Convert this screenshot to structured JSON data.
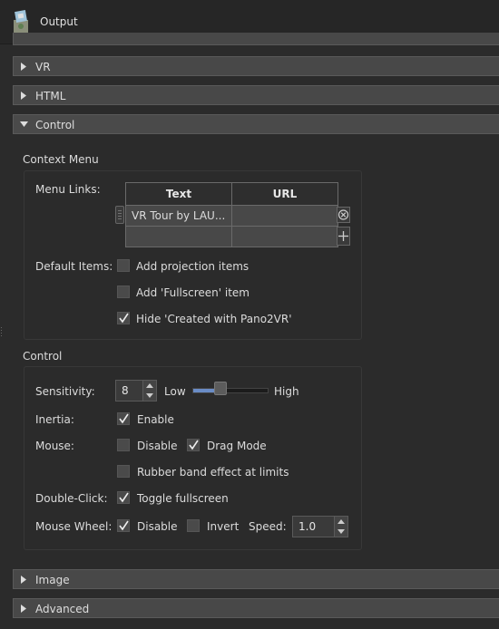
{
  "window": {
    "title": "Output",
    "icon": "pano2vr-app-icon"
  },
  "sections": {
    "vr": "VR",
    "html": "HTML",
    "control": "Control",
    "image": "Image",
    "advanced": "Advanced"
  },
  "context_menu": {
    "title": "Context Menu",
    "menu_links_label": "Menu Links:",
    "table": {
      "columns": [
        "Text",
        "URL"
      ],
      "rows": [
        {
          "text": "VR Tour by LAU...",
          "url": ""
        },
        {
          "text": "",
          "url": ""
        }
      ]
    },
    "default_items_label": "Default Items:",
    "items": [
      {
        "label": "Add projection items",
        "checked": false
      },
      {
        "label": "Add 'Fullscreen' item",
        "checked": false
      },
      {
        "label": "Hide 'Created with Pano2VR'",
        "checked": true
      }
    ]
  },
  "control": {
    "title": "Control",
    "sensitivity": {
      "label": "Sensitivity:",
      "value": "8",
      "low": "Low",
      "high": "High",
      "level": 0.3
    },
    "inertia": {
      "label": "Inertia:",
      "option": "Enable",
      "checked": true
    },
    "mouse": {
      "label": "Mouse:",
      "disable": {
        "label": "Disable",
        "checked": false
      },
      "drag_mode": {
        "label": "Drag Mode",
        "checked": true
      },
      "rubber_band": {
        "label": "Rubber band effect at limits",
        "checked": false
      }
    },
    "double_click": {
      "label": "Double-Click:",
      "option": "Toggle fullscreen",
      "checked": true
    },
    "mouse_wheel": {
      "label": "Mouse Wheel:",
      "disable": {
        "label": "Disable",
        "checked": true
      },
      "invert": {
        "label": "Invert",
        "checked": false
      },
      "speed_label": "Speed:",
      "speed_value": "1.0"
    }
  },
  "colors": {
    "accent": "#6a8cc6",
    "background": "#2b2b2b",
    "section_header": "#484848"
  }
}
